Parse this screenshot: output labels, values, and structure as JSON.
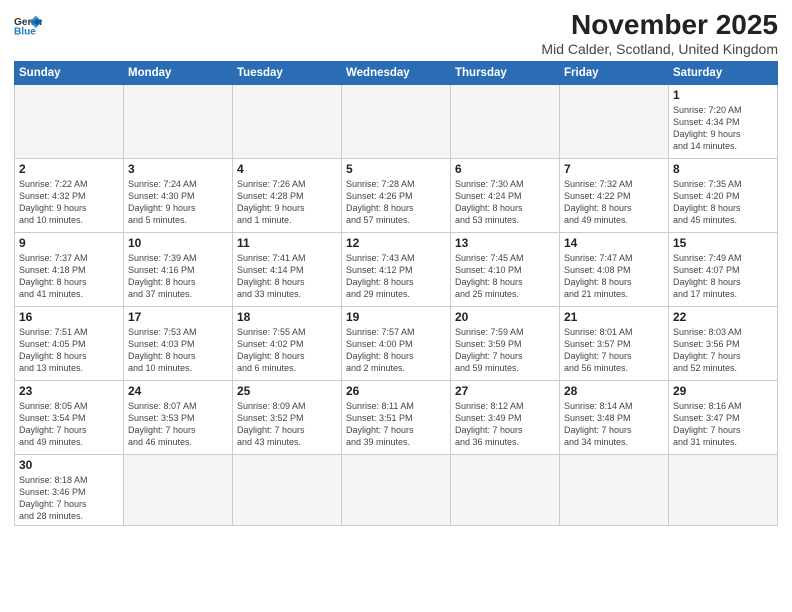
{
  "header": {
    "logo_general": "General",
    "logo_blue": "Blue",
    "title": "November 2025",
    "subtitle": "Mid Calder, Scotland, United Kingdom"
  },
  "weekdays": [
    "Sunday",
    "Monday",
    "Tuesday",
    "Wednesday",
    "Thursday",
    "Friday",
    "Saturday"
  ],
  "weeks": [
    [
      {
        "day": "",
        "info": "",
        "empty": true
      },
      {
        "day": "",
        "info": "",
        "empty": true
      },
      {
        "day": "",
        "info": "",
        "empty": true
      },
      {
        "day": "",
        "info": "",
        "empty": true
      },
      {
        "day": "",
        "info": "",
        "empty": true
      },
      {
        "day": "",
        "info": "",
        "empty": true
      },
      {
        "day": "1",
        "info": "Sunrise: 7:20 AM\nSunset: 4:34 PM\nDaylight: 9 hours\nand 14 minutes.",
        "empty": false
      }
    ],
    [
      {
        "day": "2",
        "info": "Sunrise: 7:22 AM\nSunset: 4:32 PM\nDaylight: 9 hours\nand 10 minutes.",
        "empty": false
      },
      {
        "day": "3",
        "info": "Sunrise: 7:24 AM\nSunset: 4:30 PM\nDaylight: 9 hours\nand 5 minutes.",
        "empty": false
      },
      {
        "day": "4",
        "info": "Sunrise: 7:26 AM\nSunset: 4:28 PM\nDaylight: 9 hours\nand 1 minute.",
        "empty": false
      },
      {
        "day": "5",
        "info": "Sunrise: 7:28 AM\nSunset: 4:26 PM\nDaylight: 8 hours\nand 57 minutes.",
        "empty": false
      },
      {
        "day": "6",
        "info": "Sunrise: 7:30 AM\nSunset: 4:24 PM\nDaylight: 8 hours\nand 53 minutes.",
        "empty": false
      },
      {
        "day": "7",
        "info": "Sunrise: 7:32 AM\nSunset: 4:22 PM\nDaylight: 8 hours\nand 49 minutes.",
        "empty": false
      },
      {
        "day": "8",
        "info": "Sunrise: 7:35 AM\nSunset: 4:20 PM\nDaylight: 8 hours\nand 45 minutes.",
        "empty": false
      }
    ],
    [
      {
        "day": "9",
        "info": "Sunrise: 7:37 AM\nSunset: 4:18 PM\nDaylight: 8 hours\nand 41 minutes.",
        "empty": false
      },
      {
        "day": "10",
        "info": "Sunrise: 7:39 AM\nSunset: 4:16 PM\nDaylight: 8 hours\nand 37 minutes.",
        "empty": false
      },
      {
        "day": "11",
        "info": "Sunrise: 7:41 AM\nSunset: 4:14 PM\nDaylight: 8 hours\nand 33 minutes.",
        "empty": false
      },
      {
        "day": "12",
        "info": "Sunrise: 7:43 AM\nSunset: 4:12 PM\nDaylight: 8 hours\nand 29 minutes.",
        "empty": false
      },
      {
        "day": "13",
        "info": "Sunrise: 7:45 AM\nSunset: 4:10 PM\nDaylight: 8 hours\nand 25 minutes.",
        "empty": false
      },
      {
        "day": "14",
        "info": "Sunrise: 7:47 AM\nSunset: 4:08 PM\nDaylight: 8 hours\nand 21 minutes.",
        "empty": false
      },
      {
        "day": "15",
        "info": "Sunrise: 7:49 AM\nSunset: 4:07 PM\nDaylight: 8 hours\nand 17 minutes.",
        "empty": false
      }
    ],
    [
      {
        "day": "16",
        "info": "Sunrise: 7:51 AM\nSunset: 4:05 PM\nDaylight: 8 hours\nand 13 minutes.",
        "empty": false
      },
      {
        "day": "17",
        "info": "Sunrise: 7:53 AM\nSunset: 4:03 PM\nDaylight: 8 hours\nand 10 minutes.",
        "empty": false
      },
      {
        "day": "18",
        "info": "Sunrise: 7:55 AM\nSunset: 4:02 PM\nDaylight: 8 hours\nand 6 minutes.",
        "empty": false
      },
      {
        "day": "19",
        "info": "Sunrise: 7:57 AM\nSunset: 4:00 PM\nDaylight: 8 hours\nand 2 minutes.",
        "empty": false
      },
      {
        "day": "20",
        "info": "Sunrise: 7:59 AM\nSunset: 3:59 PM\nDaylight: 7 hours\nand 59 minutes.",
        "empty": false
      },
      {
        "day": "21",
        "info": "Sunrise: 8:01 AM\nSunset: 3:57 PM\nDaylight: 7 hours\nand 56 minutes.",
        "empty": false
      },
      {
        "day": "22",
        "info": "Sunrise: 8:03 AM\nSunset: 3:56 PM\nDaylight: 7 hours\nand 52 minutes.",
        "empty": false
      }
    ],
    [
      {
        "day": "23",
        "info": "Sunrise: 8:05 AM\nSunset: 3:54 PM\nDaylight: 7 hours\nand 49 minutes.",
        "empty": false
      },
      {
        "day": "24",
        "info": "Sunrise: 8:07 AM\nSunset: 3:53 PM\nDaylight: 7 hours\nand 46 minutes.",
        "empty": false
      },
      {
        "day": "25",
        "info": "Sunrise: 8:09 AM\nSunset: 3:52 PM\nDaylight: 7 hours\nand 43 minutes.",
        "empty": false
      },
      {
        "day": "26",
        "info": "Sunrise: 8:11 AM\nSunset: 3:51 PM\nDaylight: 7 hours\nand 39 minutes.",
        "empty": false
      },
      {
        "day": "27",
        "info": "Sunrise: 8:12 AM\nSunset: 3:49 PM\nDaylight: 7 hours\nand 36 minutes.",
        "empty": false
      },
      {
        "day": "28",
        "info": "Sunrise: 8:14 AM\nSunset: 3:48 PM\nDaylight: 7 hours\nand 34 minutes.",
        "empty": false
      },
      {
        "day": "29",
        "info": "Sunrise: 8:16 AM\nSunset: 3:47 PM\nDaylight: 7 hours\nand 31 minutes.",
        "empty": false
      }
    ],
    [
      {
        "day": "30",
        "info": "Sunrise: 8:18 AM\nSunset: 3:46 PM\nDaylight: 7 hours\nand 28 minutes.",
        "empty": false
      },
      {
        "day": "",
        "info": "",
        "empty": true
      },
      {
        "day": "",
        "info": "",
        "empty": true
      },
      {
        "day": "",
        "info": "",
        "empty": true
      },
      {
        "day": "",
        "info": "",
        "empty": true
      },
      {
        "day": "",
        "info": "",
        "empty": true
      },
      {
        "day": "",
        "info": "",
        "empty": true
      }
    ]
  ]
}
